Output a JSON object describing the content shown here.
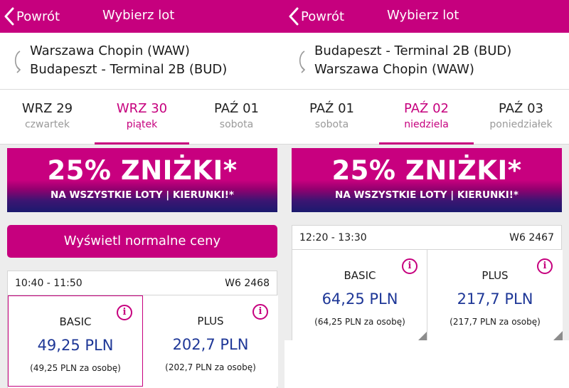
{
  "colors": {
    "brand": "#c6007e",
    "price": "#1e3797",
    "background": "#ededed"
  },
  "panels": {
    "left": {
      "back_label": "Powrót",
      "title": "Wybierz lot",
      "route": {
        "from": "Warszawa Chopin (WAW)",
        "to": "Budapeszt - Terminal 2B (BUD)"
      },
      "dates": [
        {
          "date": "WRZ 29",
          "day": "czwartek",
          "active": false
        },
        {
          "date": "WRZ 30",
          "day": "piątek",
          "active": true
        },
        {
          "date": "PAŹ 01",
          "day": "sobota",
          "active": false
        }
      ],
      "banner": {
        "line1": "25% ZNIŻKI*",
        "line2": "NA WSZYSTKIE LOTY | KIERUNKI!*"
      },
      "normal_prices_button": "Wyświetl normalne ceny",
      "flight": {
        "time": "10:40 - 11:50",
        "number": "W6 2468",
        "fares": [
          {
            "name": "BASIC",
            "price": "49,25 PLN",
            "per_person": "(49,25 PLN za osobę)",
            "selected": true,
            "icon": "info-icon"
          },
          {
            "name": "PLUS",
            "price": "202,7 PLN",
            "per_person": "(202,7 PLN za osobę)",
            "selected": false,
            "icon": "info-icon"
          }
        ]
      }
    },
    "right": {
      "back_label": "Powrót",
      "title": "Wybierz lot",
      "route": {
        "from": "Budapeszt - Terminal 2B (BUD)",
        "to": "Warszawa Chopin (WAW)"
      },
      "dates": [
        {
          "date": "PAŹ 01",
          "day": "sobota",
          "active": false
        },
        {
          "date": "PAŹ 02",
          "day": "niedziela",
          "active": true
        },
        {
          "date": "PAŹ 03",
          "day": "poniedziałek",
          "active": false
        }
      ],
      "banner": {
        "line1": "25% ZNIŻKI*",
        "line2": "NA WSZYSTKIE LOTY | KIERUNKI!*"
      },
      "flight": {
        "time": "12:20 - 13:30",
        "number": "W6 2467",
        "fares": [
          {
            "name": "BASIC",
            "price": "64,25 PLN",
            "per_person": "(64,25 PLN za osobę)",
            "selected": false,
            "icon": "info-icon"
          },
          {
            "name": "PLUS",
            "price": "217,7 PLN",
            "per_person": "(217,7 PLN za osobę)",
            "selected": false,
            "icon": "info-icon"
          }
        ]
      }
    }
  }
}
